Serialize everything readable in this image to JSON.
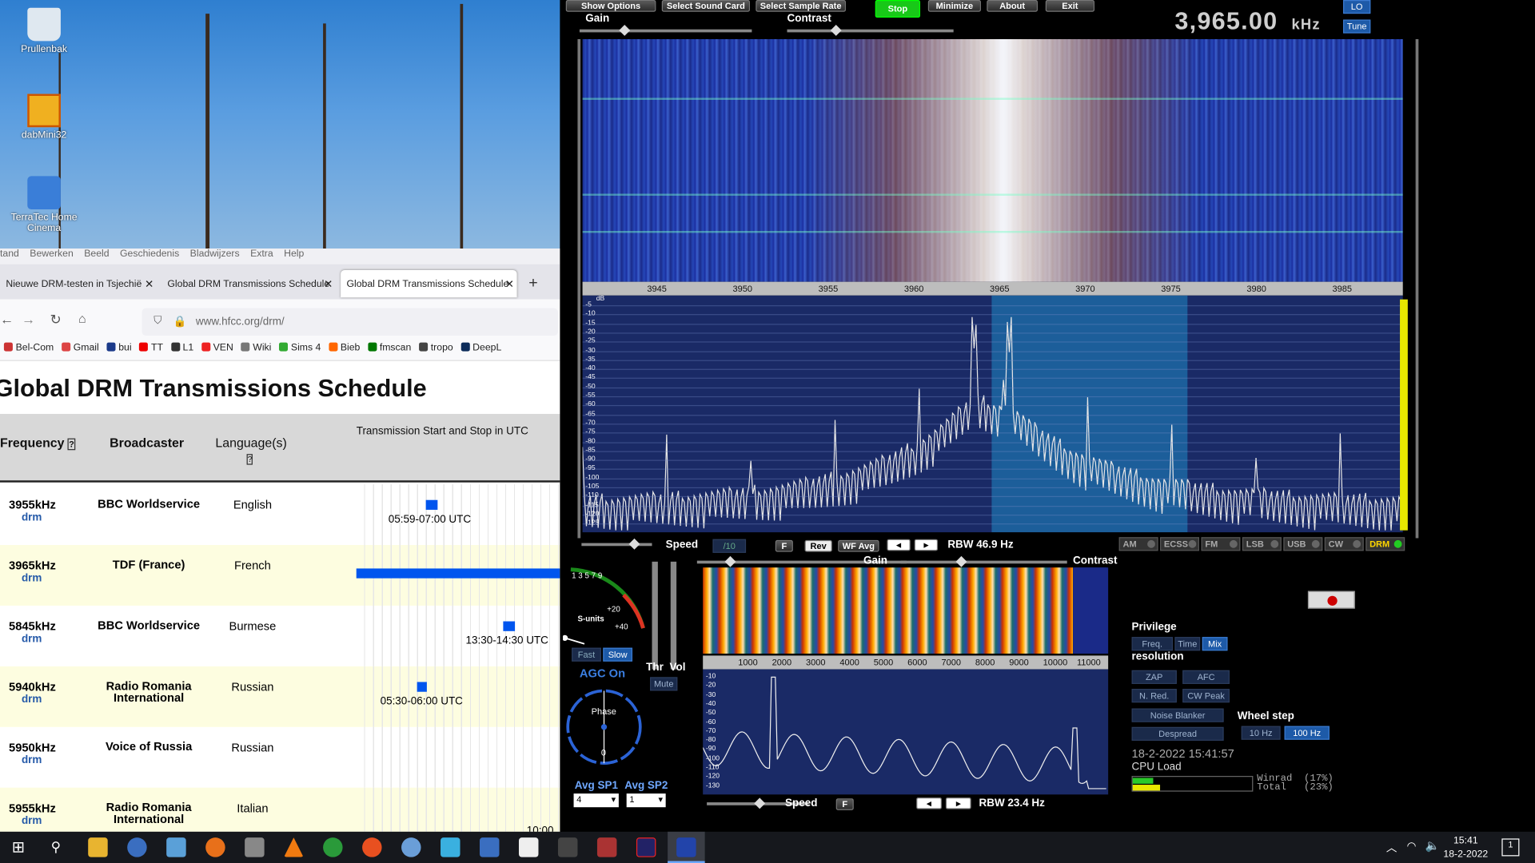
{
  "desktop": {
    "icons": [
      {
        "label": "Prullenbak"
      },
      {
        "label": "dabMini32"
      },
      {
        "label": "TerraTec Home Cinema"
      }
    ]
  },
  "browser": {
    "menu": [
      "tand",
      "Bewerken",
      "Beeld",
      "Geschiedenis",
      "Bladwijzers",
      "Extra",
      "Help"
    ],
    "tabs": [
      {
        "title": "Nieuwe DRM-testen in Tsjechië"
      },
      {
        "title": "Global DRM Transmissions Schedule"
      },
      {
        "title": "Global DRM Transmissions Schedule"
      }
    ],
    "new_tab": "+",
    "url": "www.hfcc.org/drm/",
    "bookmarks": [
      {
        "label": "Bel-Com",
        "color": "#c33"
      },
      {
        "label": "Gmail",
        "color": "#d44"
      },
      {
        "label": "bui",
        "color": "#1b3a8a"
      },
      {
        "label": "TT",
        "color": "#e00"
      },
      {
        "label": "L1",
        "color": "#333"
      },
      {
        "label": "VEN",
        "color": "#e22"
      },
      {
        "label": "Wiki",
        "color": "#777"
      },
      {
        "label": "Sims 4",
        "color": "#3a3"
      },
      {
        "label": "Bieb",
        "color": "#f60"
      },
      {
        "label": "fmscan",
        "color": "#070"
      },
      {
        "label": "tropo",
        "color": "#444"
      },
      {
        "label": "DeepL",
        "color": "#0c2b5a"
      }
    ]
  },
  "schedule": {
    "title": "Global DRM Transmissions Schedule",
    "headers": {
      "frequency": "Frequency",
      "broadcaster": "Broadcaster",
      "language": "Language(s)",
      "time": "Transmission Start and Stop in UTC"
    },
    "logo": "drm",
    "rows": [
      {
        "frequency": "3955kHz",
        "broadcaster": "BBC Worldservice",
        "language": "English",
        "time": "05:59-07:00 UTC",
        "bar_start": 0.34,
        "bar_width": 0.06
      },
      {
        "frequency": "3965kHz",
        "broadcaster": "TDF (France)",
        "language": "French",
        "time": "",
        "bar_start": 0.0,
        "bar_width": 1.0
      },
      {
        "frequency": "5845kHz",
        "broadcaster": "BBC Worldservice",
        "language": "Burmese",
        "time": "13:30-14:30 UTC",
        "bar_start": 0.72,
        "bar_width": 0.06
      },
      {
        "frequency": "5940kHz",
        "broadcaster": "Radio Romania International",
        "language": "Russian",
        "time": "05:30-06:00 UTC",
        "bar_start": 0.3,
        "bar_width": 0.04
      },
      {
        "frequency": "5950kHz",
        "broadcaster": "Voice of Russia",
        "language": "Russian",
        "time": "",
        "bar_start": 0,
        "bar_width": 0
      },
      {
        "frequency": "5955kHz",
        "broadcaster": "Radio Romania International",
        "language": "Italian",
        "time": "10:00",
        "bar_start": 0,
        "bar_width": 0
      }
    ]
  },
  "winrad": {
    "buttons": {
      "show_options": "Show Options",
      "sound_card": "Select Sound Card",
      "sample_rate": "Select Sample Rate",
      "stop": "Stop",
      "minimize": "Minimize",
      "about": "About",
      "exit": "Exit"
    },
    "gain": "Gain",
    "contrast": "Contrast",
    "frequency": "3,965.00",
    "unit": "kHz",
    "lo": "LO",
    "tune": "Tune",
    "freq_ticks": [
      "3945",
      "3950",
      "3955",
      "3960",
      "3965",
      "3970",
      "3975",
      "3980",
      "3985"
    ],
    "db_label": "dB",
    "db_ticks": [
      "-5",
      "-10",
      "-15",
      "-20",
      "-25",
      "-30",
      "-35",
      "-40",
      "-45",
      "-50",
      "-55",
      "-60",
      "-65",
      "-70",
      "-75",
      "-80",
      "-85",
      "-90",
      "-95",
      "-100",
      "-105",
      "-110",
      "-115",
      "-120",
      "-125"
    ],
    "speed": "Speed",
    "ratio": "/10",
    "f": "F",
    "rev": "Rev",
    "wf_avg": "WF Avg",
    "rbw": "RBW 46.9 Hz",
    "modes": [
      "AM",
      "ECSS",
      "FM",
      "LSB",
      "USB",
      "CW",
      "DRM"
    ],
    "active_mode": "DRM",
    "smeter": {
      "label": "S-units",
      "marks": [
        "1",
        "3",
        "5",
        "7",
        "9",
        "+20",
        "+40"
      ]
    },
    "agc": {
      "fast": "Fast",
      "slow": "Slow",
      "status": "AGC On",
      "thr": "Thr",
      "vol": "Vol",
      "mute": "Mute"
    },
    "phase": {
      "label": "Phase",
      "value": "0"
    },
    "avg": {
      "sp1_label": "Avg SP1",
      "sp1": "4",
      "sp2_label": "Avg SP2",
      "sp2": "1"
    },
    "lower": {
      "gain": "Gain",
      "contrast": "Contrast",
      "ticks": [
        "1000",
        "2000",
        "3000",
        "4000",
        "5000",
        "6000",
        "7000",
        "8000",
        "9000",
        "10000",
        "11000"
      ],
      "db_ticks": [
        "-10",
        "-20",
        "-30",
        "-40",
        "-50",
        "-60",
        "-70",
        "-80",
        "-90",
        "-100",
        "-110",
        "-120",
        "-130"
      ],
      "speed": "Speed",
      "f": "F",
      "rbw": "RBW 23.4 Hz"
    },
    "privilege": {
      "title": "Privilege",
      "options": [
        "Freq.",
        "Time",
        "Mix"
      ],
      "active": "Mix",
      "resolution": "resolution"
    },
    "dsp": {
      "zap": "ZAP",
      "afc": "AFC",
      "nred": "N. Red.",
      "cwpeak": "CW Peak",
      "nb": "Noise Blanker",
      "despread": "Despread"
    },
    "wheel": {
      "title": "Wheel step",
      "options": [
        "10 Hz",
        "100 Hz"
      ],
      "active": "100 Hz"
    },
    "datetime": "18-2-2022 15:41:57",
    "cpu": {
      "title": "CPU Load",
      "winrad": "Winrad  (17%)",
      "total": "Total   (23%)",
      "winrad_pct": 17,
      "total_pct": 23
    }
  },
  "taskbar": {
    "time": "15:41",
    "date": "18-2-2022",
    "notifications": "1"
  }
}
